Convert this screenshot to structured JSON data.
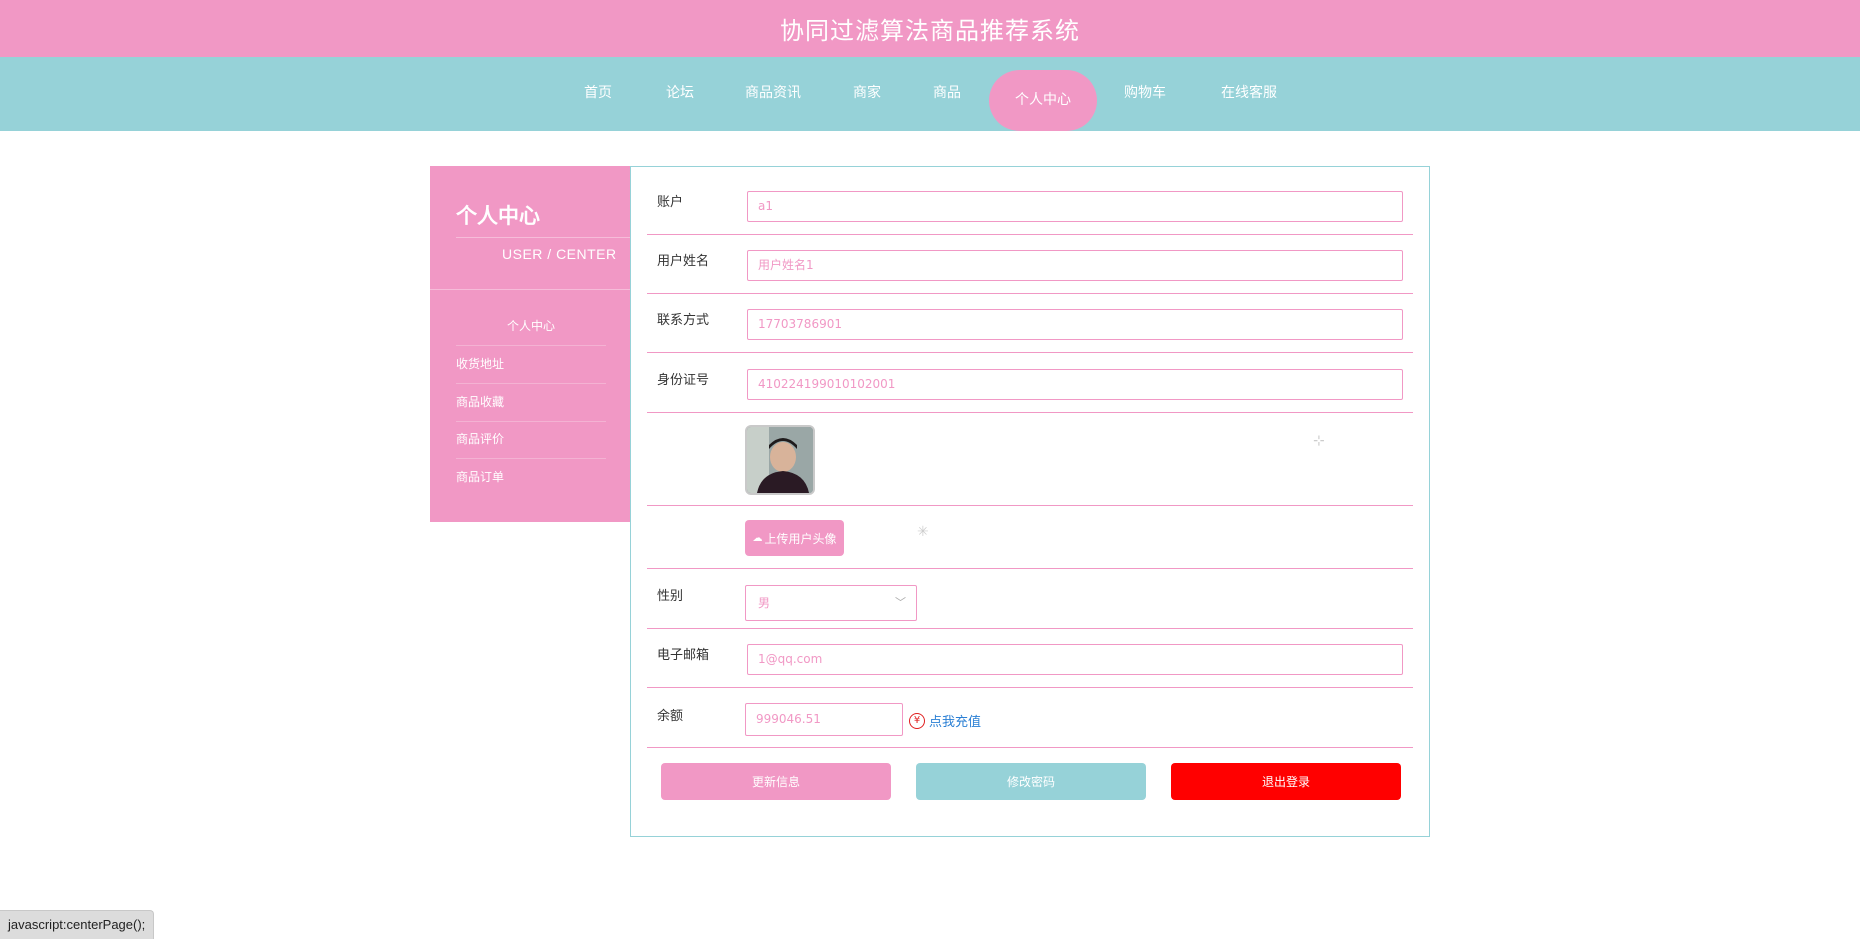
{
  "header": {
    "title": "协同过滤算法商品推荐系统"
  },
  "nav": {
    "items": [
      {
        "label": "首页"
      },
      {
        "label": "论坛"
      },
      {
        "label": "商品资讯"
      },
      {
        "label": "商家"
      },
      {
        "label": "商品"
      },
      {
        "label": "个人中心",
        "active": true
      },
      {
        "label": "购物车"
      },
      {
        "label": "在线客服"
      }
    ]
  },
  "sidebar": {
    "title": "个人中心",
    "subtitle": "USER / CENTER",
    "items": [
      {
        "label": "个人中心",
        "active": true
      },
      {
        "label": "收货地址"
      },
      {
        "label": "商品收藏"
      },
      {
        "label": "商品评价"
      },
      {
        "label": "商品订单"
      }
    ]
  },
  "form": {
    "account": {
      "label": "账户",
      "value": "a1"
    },
    "username": {
      "label": "用户姓名",
      "value": "用户姓名1"
    },
    "phone": {
      "label": "联系方式",
      "value": "17703786901"
    },
    "idcard": {
      "label": "身份证号",
      "value": "410224199010102001"
    },
    "upload_label": "上传用户头像",
    "gender": {
      "label": "性别",
      "value": "男"
    },
    "email": {
      "label": "电子邮箱",
      "value": "1@qq.com"
    },
    "balance": {
      "label": "余额",
      "value": "999046.51",
      "recharge_label": "点我充值"
    }
  },
  "buttons": {
    "update": "更新信息",
    "change_password": "修改密码",
    "logout": "退出登录"
  },
  "statusbar": {
    "text": "javascript:centerPage();"
  },
  "colors": {
    "pink": "#f198c5",
    "teal": "#96d2d8",
    "red": "#ff0000",
    "link": "#2a7fd4"
  }
}
